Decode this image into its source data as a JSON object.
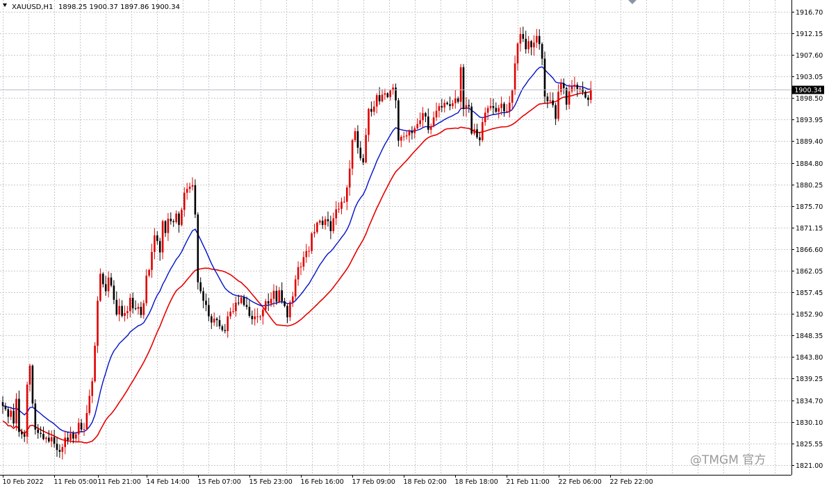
{
  "header": {
    "symbol_label": "XAUUSD,H1",
    "ohlc_text": "1898.25 1900.37 1897.86 1900.34"
  },
  "watermark": {
    "text": "@TMGM 官方"
  },
  "current_price_label": "1900.34",
  "chart_data": {
    "type": "candlestick",
    "symbol": "XAUUSD",
    "timeframe": "H1",
    "ylim": [
      1821.0,
      1918.0
    ],
    "grid": true,
    "y_ticks": [
      "1916.70",
      "1912.15",
      "1907.60",
      "1903.05",
      "1898.50",
      "1893.95",
      "1889.40",
      "1884.80",
      "1880.25",
      "1875.70",
      "1871.15",
      "1866.60",
      "1862.05",
      "1857.45",
      "1852.90",
      "1848.35",
      "1843.80",
      "1839.25",
      "1834.70",
      "1830.10",
      "1825.55",
      "1821.00"
    ],
    "x_tick_labels": [
      {
        "label": "10 Feb 2022",
        "bar": 0
      },
      {
        "label": "11 Feb 05:00",
        "bar": 19
      },
      {
        "label": "11 Feb 21:00",
        "bar": 35
      },
      {
        "label": "14 Feb 14:00",
        "bar": 53
      },
      {
        "label": "15 Feb 07:00",
        "bar": 72
      },
      {
        "label": "15 Feb 23:00",
        "bar": 91
      },
      {
        "label": "16 Feb 16:00",
        "bar": 110
      },
      {
        "label": "17 Feb 09:00",
        "bar": 129
      },
      {
        "label": "18 Feb 02:00",
        "bar": 148
      },
      {
        "label": "18 Feb 18:00",
        "bar": 167
      },
      {
        "label": "21 Feb 11:00",
        "bar": 186
      },
      {
        "label": "22 Feb 06:00",
        "bar": 205
      },
      {
        "label": "22 Feb 22:00",
        "bar": 224
      }
    ],
    "current_price": 1900.34,
    "closes": [
      1833.5,
      1832.8,
      1831.2,
      1832.5,
      1829.8,
      1835.0,
      1828.0,
      1827.5,
      1827.0,
      1838.0,
      1842.0,
      1834.0,
      1828.5,
      1827.8,
      1827.6,
      1826.5,
      1826.8,
      1826.0,
      1826.9,
      1825.5,
      1824.2,
      1823.8,
      1824.8,
      1826.8,
      1826.3,
      1827.7,
      1826.6,
      1827.5,
      1829.9,
      1828.5,
      1828.6,
      1832.0,
      1835.6,
      1838.7,
      1846.2,
      1855.7,
      1861.4,
      1859.2,
      1857.7,
      1860.6,
      1858.9,
      1855.9,
      1852.8,
      1854.6,
      1852.5,
      1853.1,
      1853.5,
      1856.3,
      1854.1,
      1854.0,
      1854.4,
      1852.7,
      1855.2,
      1861.0,
      1862.2,
      1866.0,
      1869.5,
      1868.3,
      1865.9,
      1872.5,
      1870.0,
      1873.0,
      1872.5,
      1872.3,
      1874.1,
      1871.7,
      1874.9,
      1878.5,
      1879.3,
      1879.8,
      1880.1,
      1873.9,
      1859.6,
      1857.7,
      1855.7,
      1854.8,
      1852.4,
      1851.1,
      1851.9,
      1851.6,
      1850.3,
      1849.5,
      1849.3,
      1852.4,
      1853.4,
      1853.5,
      1855.3,
      1855.2,
      1856.4,
      1854.8,
      1854.4,
      1852.5,
      1851.8,
      1852.4,
      1852.4,
      1852.4,
      1853.8,
      1855.6,
      1855.1,
      1856.1,
      1857.8,
      1855.5,
      1857.9,
      1855.6,
      1854.6,
      1852.2,
      1855.4,
      1856.6,
      1860.2,
      1862.8,
      1862.9,
      1864.9,
      1866.2,
      1866.2,
      1869.9,
      1870.2,
      1872.2,
      1872.6,
      1871.7,
      1872.9,
      1872.5,
      1870.4,
      1873.1,
      1875.0,
      1875.1,
      1876.6,
      1876.6,
      1879.6,
      1883.6,
      1889.6,
      1891.5,
      1888.0,
      1885.8,
      1884.9,
      1890.7,
      1896.2,
      1895.6,
      1896.7,
      1899.1,
      1897.8,
      1899.2,
      1899.5,
      1898.7,
      1900.1,
      1900.7,
      1898.0,
      1889.5,
      1890.3,
      1890.4,
      1890.6,
      1891.5,
      1891.1,
      1892.1,
      1893.0,
      1893.8,
      1895.3,
      1894.6,
      1891.8,
      1892.5,
      1894.4,
      1895.8,
      1896.8,
      1896.5,
      1897.5,
      1897.2,
      1896.8,
      1897.4,
      1898.4,
      1897.7,
      1905.0,
      1896.2,
      1897.0,
      1896.7,
      1891.0,
      1891.9,
      1890.2,
      1889.6,
      1893.4,
      1895.4,
      1896.4,
      1896.8,
      1896.4,
      1895.6,
      1896.4,
      1897.3,
      1895.7,
      1895.7,
      1897.5,
      1900.1,
      1905.8,
      1910.0,
      1912.0,
      1911.0,
      1908.8,
      1910.5,
      1909.2,
      1910.2,
      1911.6,
      1909.9,
      1906.8,
      1898.8,
      1897.8,
      1898.0,
      1897.0,
      1894.1,
      1899.8,
      1901.6,
      1900.6,
      1897.1,
      1899.9,
      1900.9,
      1901.3,
      1900.4,
      1900.5,
      1899.8,
      1898.6,
      1898.1,
      1900.34
    ]
  }
}
